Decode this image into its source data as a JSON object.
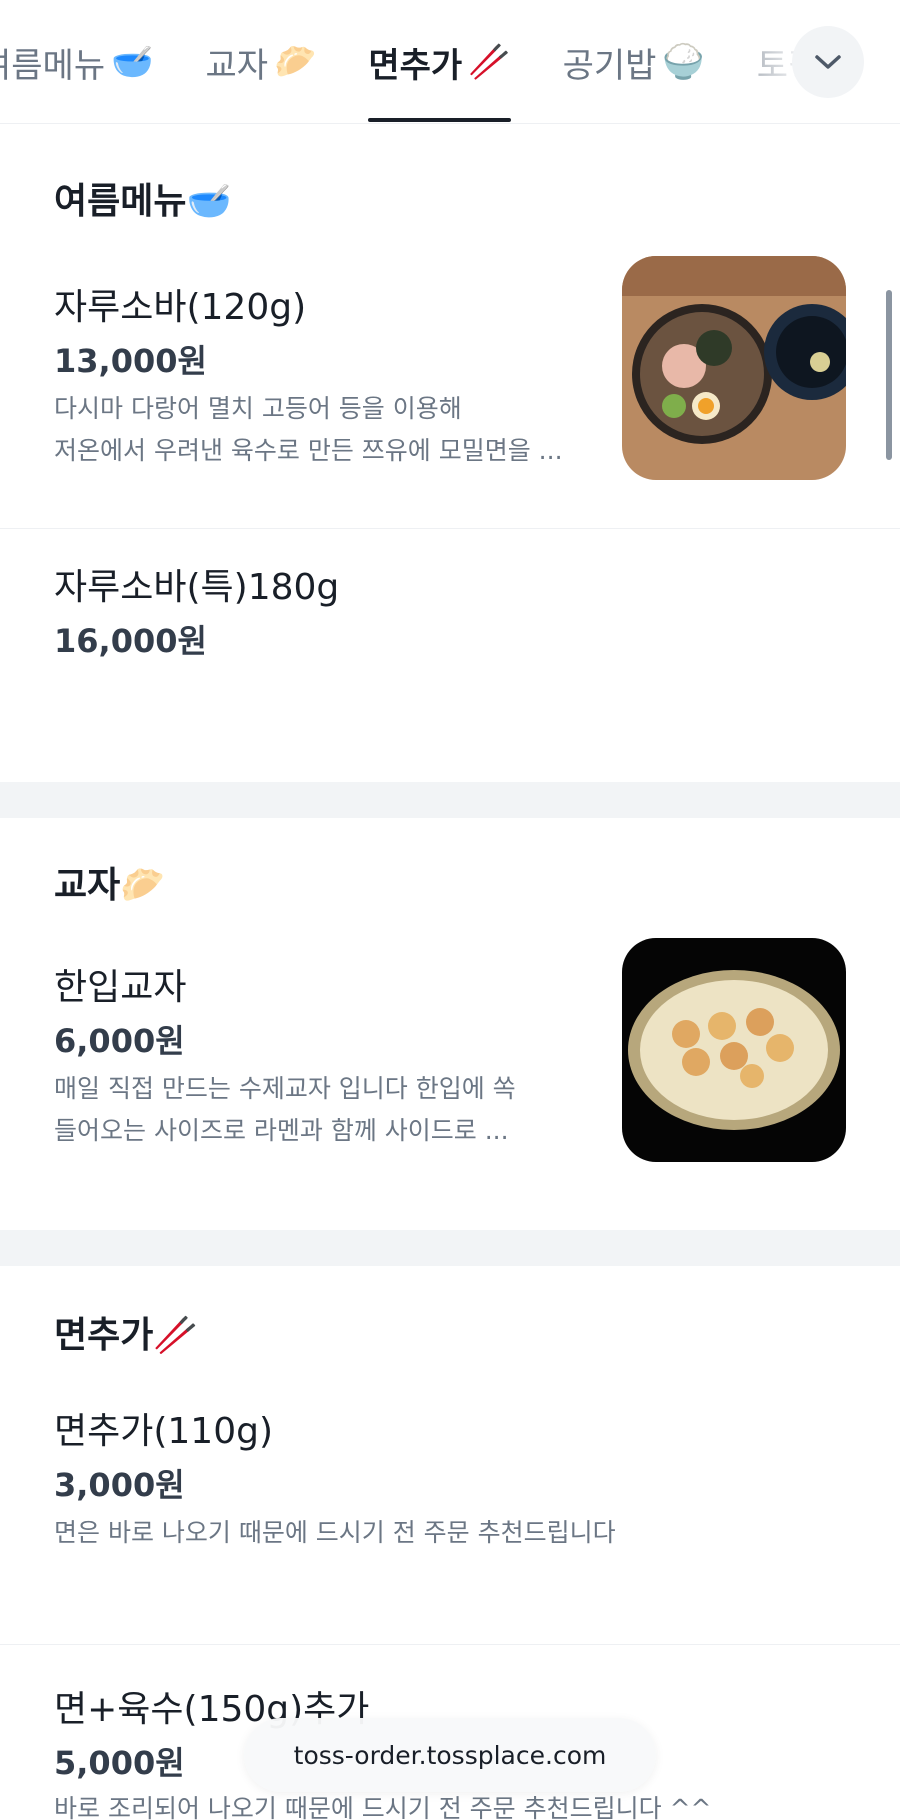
{
  "tabs": [
    {
      "label": "여름메뉴",
      "emoji": "🥣",
      "active": false
    },
    {
      "label": "교자",
      "emoji": "🥟",
      "active": false
    },
    {
      "label": "면추가",
      "emoji": "🥢",
      "active": true
    },
    {
      "label": "공기밥",
      "emoji": "🍚",
      "active": false
    },
    {
      "label": "토핑",
      "emoji": "",
      "active": false
    }
  ],
  "expand_icon": "chevron-down-icon",
  "sections": {
    "summer": {
      "title": "여름메뉴🥣",
      "items": [
        {
          "name": "자루소바(120g)",
          "price": "13,000원",
          "desc_line1": "다시마 다랑어 멸치 고등어 등을 이용해",
          "desc_line2": "저온에서 우려낸 육수로 만든 쯔유에 모밀면을 ...",
          "image": "zaru-soba-photo"
        },
        {
          "name": "자루소바(특)180g",
          "price": "16,000원"
        }
      ]
    },
    "gyoza": {
      "title": "교자🥟",
      "items": [
        {
          "name": "한입교자",
          "price": "6,000원",
          "desc_line1": "매일 직접 만드는 수제교자 입니다 한입에 쏙",
          "desc_line2": "들어오는 사이즈로 라멘과 함께 사이드로 ...",
          "image": "gyoza-photo"
        }
      ]
    },
    "noodle": {
      "title": "면추가🥢",
      "items": [
        {
          "name": "면추가(110g)",
          "price": "3,000원",
          "desc_line1": "면은 바로 나오기 때문에 드시기 전 주문 추천드립니다"
        },
        {
          "name": "면+육수(150g)추가",
          "price": "5,000원",
          "desc_line1": "바로 조리되어 나오기 때문에 드시기 전 주문 추천드립니다 ^^"
        }
      ]
    }
  },
  "url_bar": {
    "text": "toss-order.tossplace.com"
  },
  "colors": {
    "text": "#191f28",
    "sub": "#6b7684",
    "gap": "#f2f4f6"
  }
}
